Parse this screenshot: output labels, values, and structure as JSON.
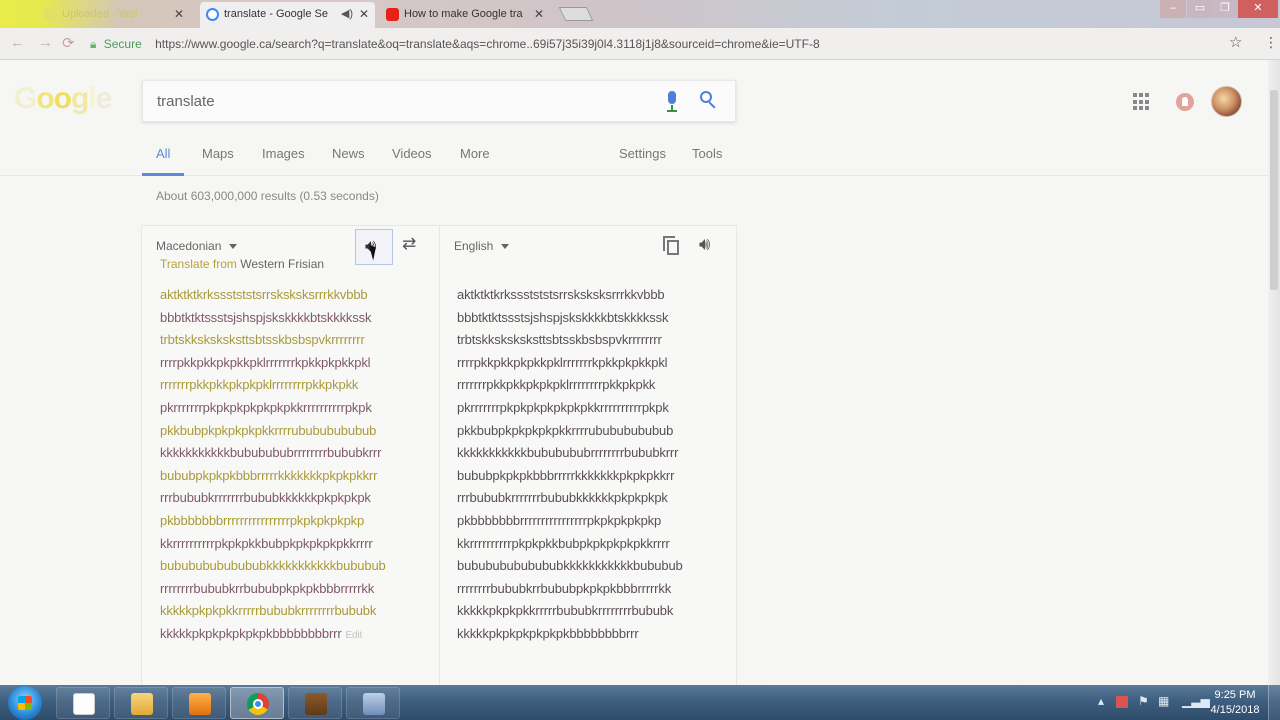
{
  "browser": {
    "tabs": [
      {
        "title": "Uploaded - Wel",
        "active": false
      },
      {
        "title": "translate - Google Se",
        "active": true
      },
      {
        "title": "How to make Google tra",
        "active": false
      }
    ],
    "secure_label": "Secure",
    "url": "https://www.google.ca/search?q=translate&oq=translate&aqs=chrome..69i57j35i39j0l4.3118j1j8&sourceid=chrome&ie=UTF-8"
  },
  "search": {
    "query": "translate"
  },
  "nav": {
    "tabs": [
      "All",
      "Maps",
      "Images",
      "News",
      "Videos",
      "More"
    ],
    "settings": "Settings",
    "tools": "Tools"
  },
  "stats": "About 603,000,000 results (0.53 seconds)",
  "translate": {
    "source_language": "Macedonian",
    "target_language": "English",
    "translate_from_prefix": "Translate from",
    "detected_language": "Western Frisian",
    "edit_label": "Edit",
    "lines": [
      "aktktktkrkssstststsrrsksksksrrrkkvbbb",
      "bbbtktktssstsjshspjskskkkkbtskkkkssk",
      "trbtskksksksksttsbtsskbsbspvkrrrrrrrr",
      "rrrrpkkpkkpkpkkpklrrrrrrrkpkkpkpkkpkl",
      "rrrrrrrpkkpkkpkpkpklrrrrrrrrpkkpkpkk",
      "pkrrrrrrrpkpkpkpkpkpkpkkrrrrrrrrrrpkpk",
      "pkkbubpkpkpkpkpkkrrrrubububububub",
      "kkkkkkkkkkkbububububrrrrrrrrbububkrrr",
      "bububpkpkpkbbbrrrrrkkkkkkkpkpkpkkrr",
      "rrrbububkrrrrrrrbububkkkkkkpkpkpkpk",
      "pkbbbbbbbrrrrrrrrrrrrrrrrpkpkpkpkpkp",
      "kkrrrrrrrrrrpkpkpkkbubpkpkpkpkpkkrrrr",
      "bubububububububkkkkkkkkkkkbububub",
      "rrrrrrrrbububkrrbububpkpkpkbbbrrrrrkk",
      "kkkkkpkpkpkkrrrrrbububkrrrrrrrrbububk",
      "kkkkkpkpkpkpkpkpkbbbbbbbbrrr"
    ]
  },
  "taskbar": {
    "time": "9:25 PM",
    "date": "4/15/2018"
  },
  "colors": {
    "accent_blue": "#5b8bd9",
    "taskbar": "#3f5f80"
  }
}
